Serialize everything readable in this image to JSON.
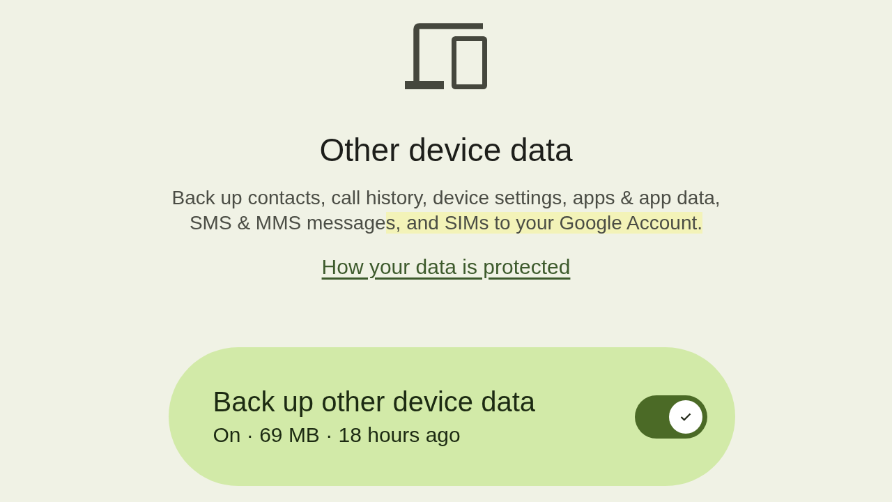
{
  "title": "Other device data",
  "description": [
    {
      "text": "Back up contacts, call history, device settings, apps & app data, SMS & MMS message",
      "highlighted": false
    },
    {
      "text": "s, and SIMs to your Google Account.",
      "highlighted": true
    }
  ],
  "link": "How your data is protected",
  "backup_setting": {
    "title": "Back up other device data",
    "status": "On · 69 MB · 18 hours ago",
    "on": true
  }
}
